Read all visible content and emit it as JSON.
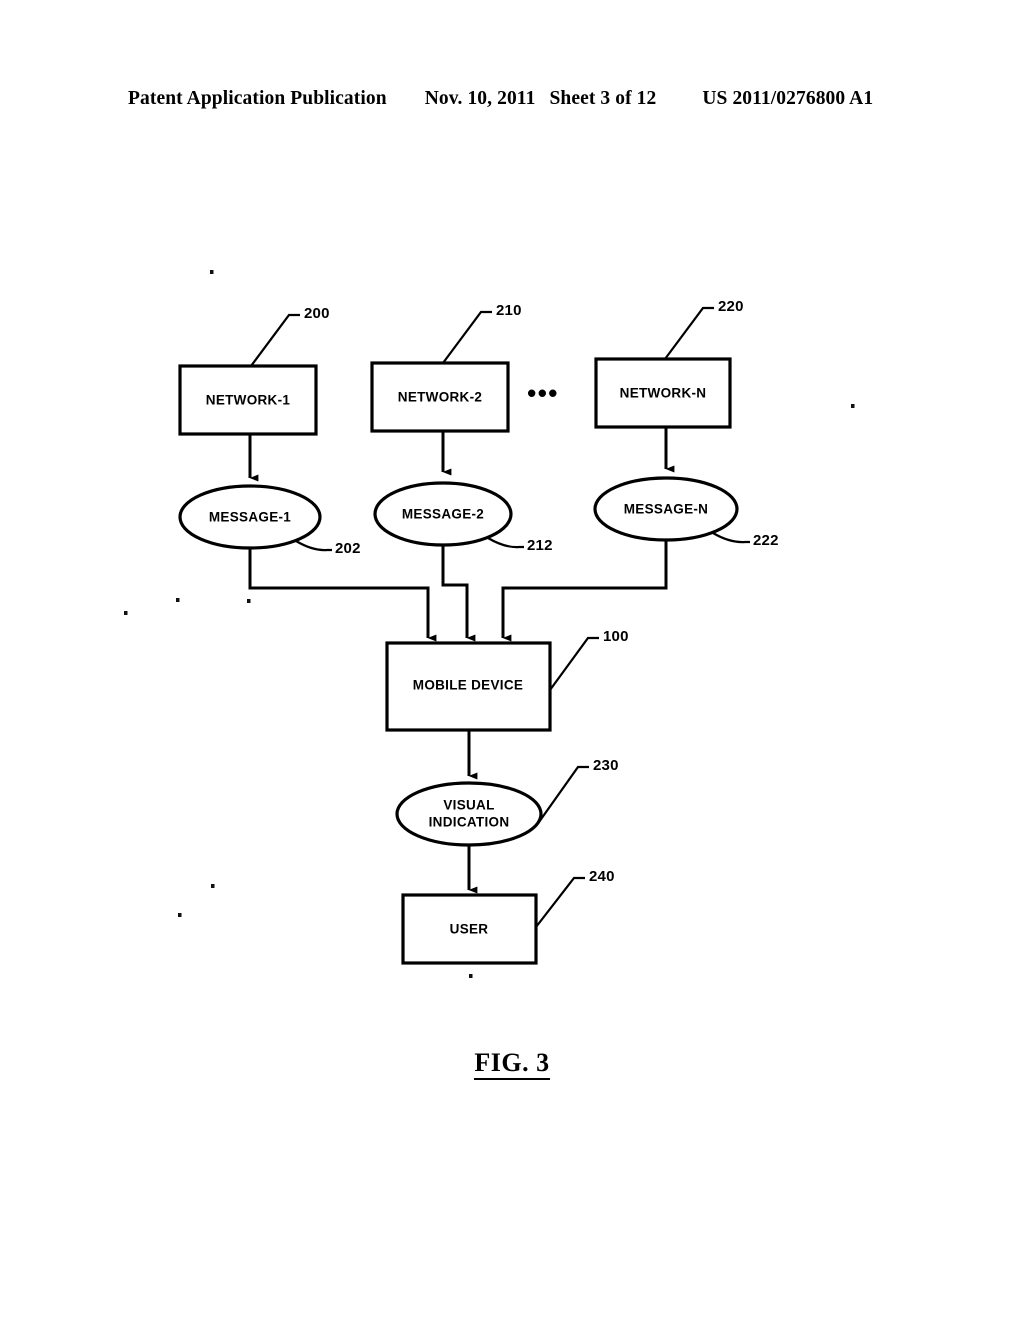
{
  "header": {
    "publication": "Patent Application Publication",
    "date": "Nov. 10, 2011",
    "sheet": "Sheet 3 of 12",
    "patent_number": "US 2011/0276800 A1"
  },
  "figure": {
    "caption": "FIG. 3",
    "ellipsis": "•••",
    "nodes": [
      {
        "id": "network-1",
        "label": "NETWORK-1",
        "ref": "200",
        "shape": "box"
      },
      {
        "id": "network-2",
        "label": "NETWORK-2",
        "ref": "210",
        "shape": "box"
      },
      {
        "id": "network-n",
        "label": "NETWORK-N",
        "ref": "220",
        "shape": "box"
      },
      {
        "id": "message-1",
        "label": "MESSAGE-1",
        "ref": "202",
        "shape": "ellipse"
      },
      {
        "id": "message-2",
        "label": "MESSAGE-2",
        "ref": "212",
        "shape": "ellipse"
      },
      {
        "id": "message-n",
        "label": "MESSAGE-N",
        "ref": "222",
        "shape": "ellipse"
      },
      {
        "id": "mobile-device",
        "label": "MOBILE DEVICE",
        "ref": "100",
        "shape": "box"
      },
      {
        "id": "visual-indication",
        "label_line1": "VISUAL",
        "label_line2": "INDICATION",
        "ref": "230",
        "shape": "ellipse"
      },
      {
        "id": "user",
        "label": "USER",
        "ref": "240",
        "shape": "box"
      }
    ],
    "colors": {
      "stroke": "#000000",
      "fill": "#ffffff",
      "background": "#ffffff"
    }
  }
}
